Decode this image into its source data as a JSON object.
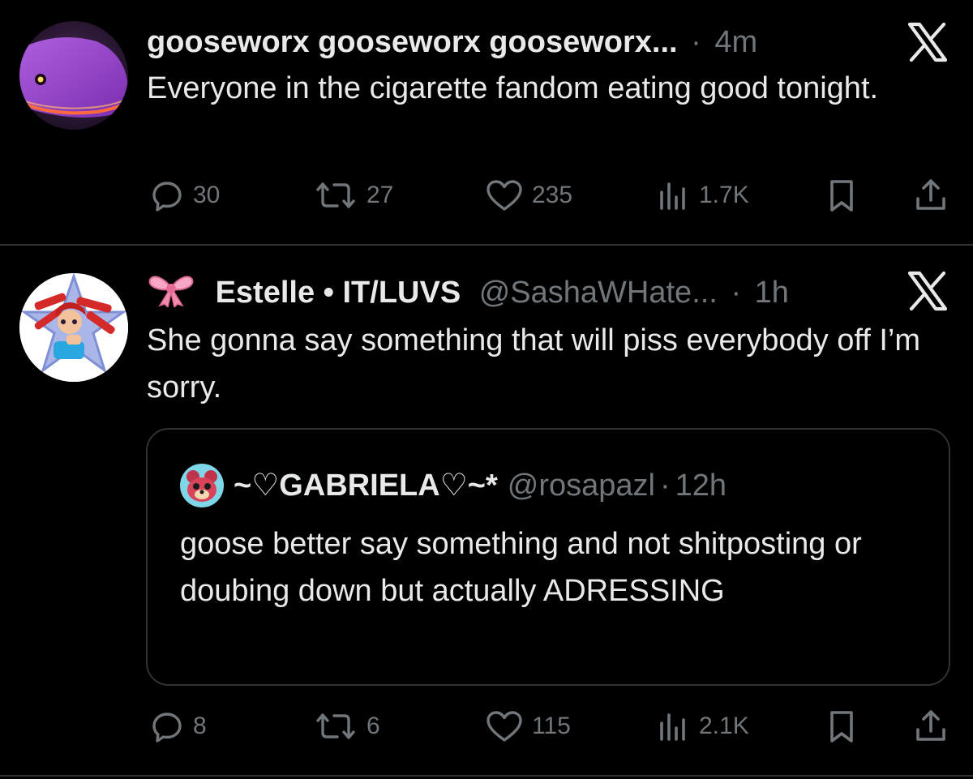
{
  "tweets": [
    {
      "display_name": "gooseworx gooseworx gooseworx...",
      "handle": "",
      "time": "4m",
      "text": "Everyone in the cigarette fandom eating good tonight.",
      "actions": {
        "replies": "30",
        "reposts": "27",
        "likes": "235",
        "views": "1.7K"
      }
    },
    {
      "name_emoji": "🎀",
      "display_name": "Estelle • IT/LUVS",
      "handle": "@SashaWHate...",
      "time": "1h",
      "text": "She gonna say something that will piss everybody off I’m sorry.",
      "quote": {
        "display_name": "~♡GABRIELA♡~*",
        "handle": "@rosapazl",
        "time": "12h",
        "text": "goose better say something and not shitposting or doubing down but actually ADRESSING"
      },
      "actions": {
        "replies": "8",
        "reposts": "6",
        "likes": "115",
        "views": "2.1K"
      }
    }
  ],
  "separator": "·",
  "icons": {
    "reply": "reply-icon",
    "repost": "repost-icon",
    "like": "heart-icon",
    "views": "views-icon",
    "bookmark": "bookmark-icon",
    "share": "share-icon",
    "logo": "x-logo-icon"
  },
  "colors": {
    "background": "#000000",
    "text": "#e7e9ea",
    "secondary": "#71767b",
    "border": "#2f3336"
  }
}
